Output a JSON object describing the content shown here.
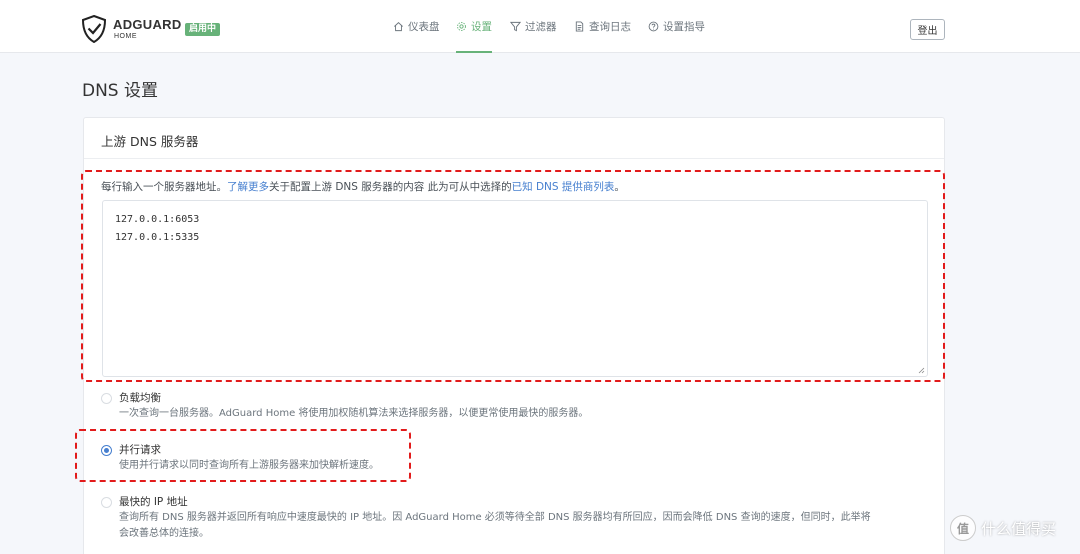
{
  "header": {
    "brand": "ADGUARD",
    "brand_sub": "HOME",
    "status_badge": "启用中",
    "nav": [
      {
        "label": "仪表盘",
        "icon": "home-icon"
      },
      {
        "label": "设置",
        "icon": "gear-icon",
        "active": true
      },
      {
        "label": "过滤器",
        "icon": "filter-icon"
      },
      {
        "label": "查询日志",
        "icon": "document-icon"
      },
      {
        "label": "设置指导",
        "icon": "help-circle-icon"
      }
    ],
    "logout": "登出",
    "accent_color": "#67b279"
  },
  "page": {
    "title": "DNS 设置"
  },
  "upstream": {
    "title": "上游 DNS 服务器",
    "help_prefix": "每行输入一个服务器地址。",
    "help_link1": "了解更多",
    "help_middle": "关于配置上游 DNS 服务器的内容 此为可从中选择的",
    "help_link2": "已知 DNS 提供商列表",
    "help_suffix": "。",
    "servers": [
      "127.0.0.1:6053",
      "127.0.0.1:5335"
    ],
    "modes": [
      {
        "label": "负载均衡",
        "desc": "一次查询一台服务器。AdGuard Home 将使用加权随机算法来选择服务器，以便更常使用最快的服务器。",
        "checked": false
      },
      {
        "label": "并行请求",
        "desc": "使用并行请求以同时查询所有上游服务器来加快解析速度。",
        "checked": true
      },
      {
        "label": "最快的 IP 地址",
        "desc": "查询所有 DNS 服务器并返回所有响应中速度最快的 IP 地址。因 AdGuard Home 必须等待全部 DNS 服务器均有所回应，因而会降低 DNS 查询的速度，但同时，此举将",
        "desc2": "会改善总体的连接。",
        "checked": false
      }
    ],
    "link_color": "#467fcf"
  },
  "watermark": {
    "icon_text": "值",
    "text": "什么值得买"
  }
}
